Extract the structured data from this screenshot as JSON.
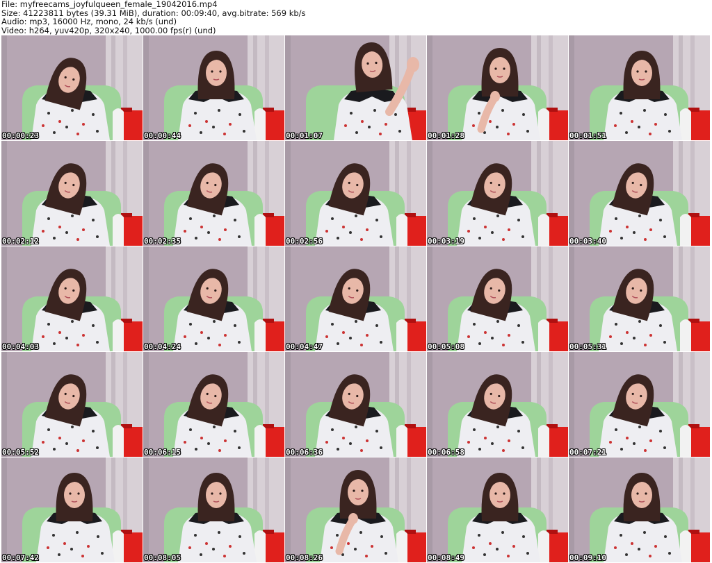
{
  "header": {
    "file_line": "File: myfreecams_joyfulqueen_female_19042016.mp4",
    "size_line": "Size: 41223811 bytes (39.31 MiB), duration: 00:09:40, avg.bitrate: 569 kb/s",
    "audio_line": "Audio: mp3, 16000 Hz, mono, 24 kb/s (und)",
    "video_line": "Video: h264, yuv420p, 320x240, 1000.00 fps(r) (und)"
  },
  "frames": [
    {
      "time": "00:00:23",
      "pose": "down"
    },
    {
      "time": "00:00:44",
      "pose": "look"
    },
    {
      "time": "00:01:07",
      "pose": "wave"
    },
    {
      "time": "00:01:28",
      "pose": "hand"
    },
    {
      "time": "00:01:51",
      "pose": "look"
    },
    {
      "time": "00:02:12",
      "pose": "down"
    },
    {
      "time": "00:02:35",
      "pose": "down"
    },
    {
      "time": "00:02:56",
      "pose": "down"
    },
    {
      "time": "00:03:19",
      "pose": "down"
    },
    {
      "time": "00:03:40",
      "pose": "down"
    },
    {
      "time": "00:04:03",
      "pose": "down"
    },
    {
      "time": "00:04:24",
      "pose": "down"
    },
    {
      "time": "00:04:47",
      "pose": "down"
    },
    {
      "time": "00:05:08",
      "pose": "down"
    },
    {
      "time": "00:05:31",
      "pose": "down"
    },
    {
      "time": "00:05:52",
      "pose": "down"
    },
    {
      "time": "00:06:15",
      "pose": "down"
    },
    {
      "time": "00:06:36",
      "pose": "down"
    },
    {
      "time": "00:06:58",
      "pose": "down"
    },
    {
      "time": "00:07:21",
      "pose": "down"
    },
    {
      "time": "00:07:42",
      "pose": "look"
    },
    {
      "time": "00:08:05",
      "pose": "look"
    },
    {
      "time": "00:08:26",
      "pose": "hand"
    },
    {
      "time": "00:08:49",
      "pose": "look"
    },
    {
      "time": "00:09:10",
      "pose": "look"
    }
  ],
  "colors": {
    "wall": "#b6a6b3",
    "wall_light": "#d8d0d6",
    "chair": "#9ed49a",
    "red_bag": "#e0201c",
    "hair": "#3a2420",
    "skin": "#e8b8a8",
    "shirt": "#eeeef2",
    "collar": "#1a1a1e"
  }
}
